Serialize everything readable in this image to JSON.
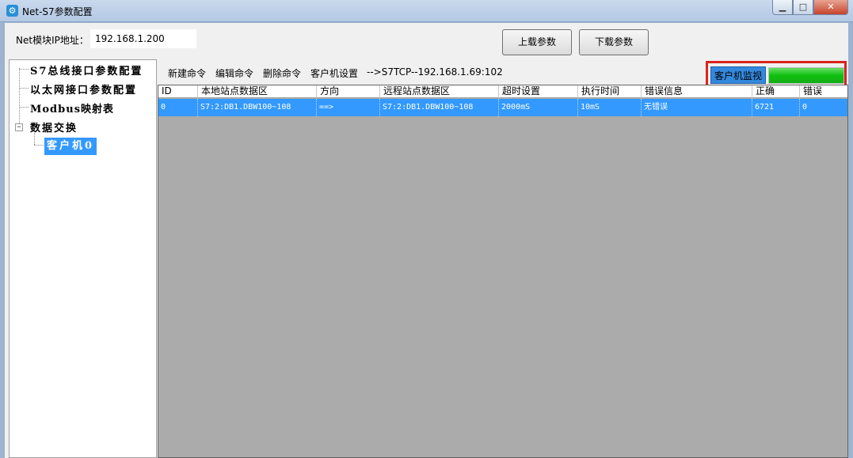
{
  "window": {
    "title": "Net-S7参数配置",
    "minimize": "▁",
    "maximize": "□",
    "close": "✕"
  },
  "header": {
    "ip_label": "Net模块IP地址：",
    "ip_value": "192.168.1.200",
    "upload_label": "上载参数",
    "download_label": "下载参数"
  },
  "tree": {
    "items": [
      {
        "label": "S7总线接口参数配置"
      },
      {
        "label": "以太网接口参数配置"
      },
      {
        "label": "Modbus映射表"
      },
      {
        "label": "数据交换"
      }
    ],
    "expander": "−",
    "selected_child": "客户机0"
  },
  "toolbar": {
    "new_command": "新建命令",
    "edit_command": "编辑命令",
    "delete_command": "删除命令",
    "client_settings": "客户机设置",
    "connection": "-->S7TCP--192.168.1.69:102",
    "monitor_label": "客户机监视",
    "monitor_progress": 1.0
  },
  "table": {
    "columns": [
      "ID",
      "本地站点数据区",
      "方向",
      "远程站点数据区",
      "超时设置",
      "执行时间",
      "错误信息",
      "正确",
      "错误"
    ],
    "rows": [
      [
        "0",
        "S7:2:DB1.DBW100~108",
        "==>",
        "S7:2:DB1.DBW100~108",
        "2000mS",
        "10mS",
        "无错误",
        "6721",
        "0"
      ]
    ]
  },
  "colors": {
    "selection": "#3399ff",
    "monitor_highlight": "#d9251c",
    "progress": "#16ad16"
  }
}
